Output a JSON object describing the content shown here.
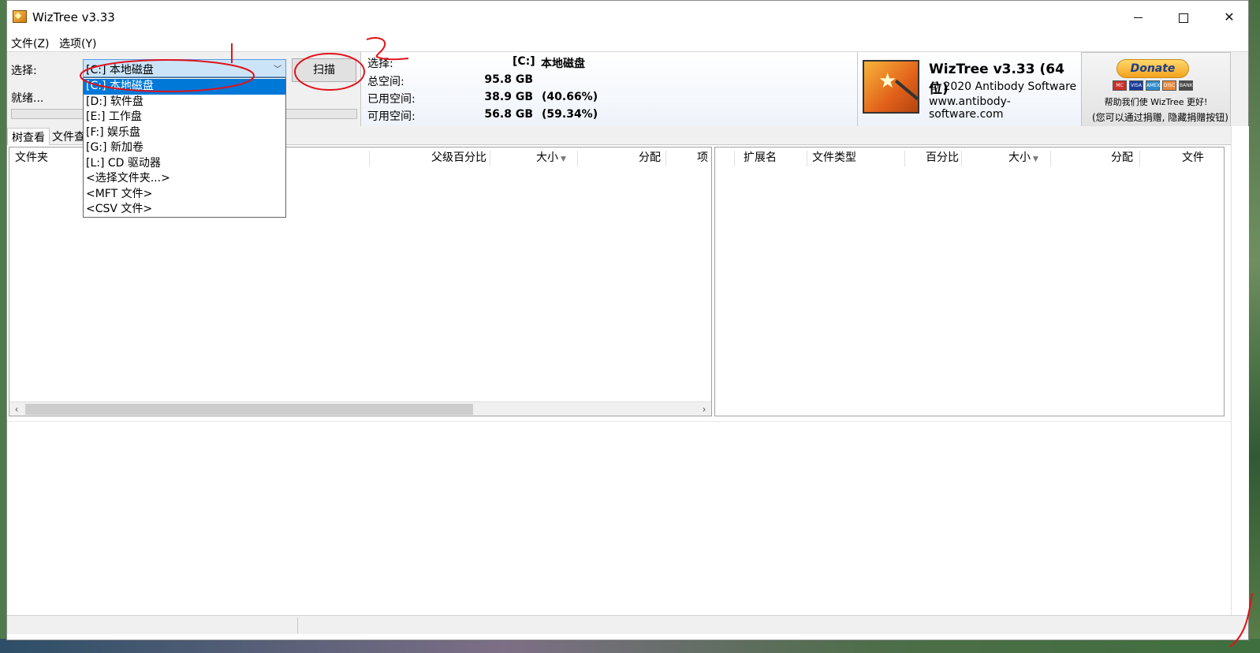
{
  "window": {
    "title": "WizTree v3.33",
    "min_glyph": "",
    "close_glyph": "✕"
  },
  "menu": [
    "文件(Z)",
    "选项(Y)"
  ],
  "toolbar": {
    "select_label": "选择:",
    "status_label": "就绪...",
    "combo_value": "[C:] 本地磁盘",
    "combo_arrow": "﹀",
    "scan_label": "扫描"
  },
  "drive_info": {
    "select_label": "选择:",
    "drive": "[C:]",
    "drive_name": "本地磁盘",
    "total_label": "总空间:",
    "total_value": "95.8 GB",
    "used_label": "已用空间:",
    "used_value": "38.9 GB",
    "used_pct": "(40.66%)",
    "free_label": "可用空间:",
    "free_value": "56.8 GB",
    "free_pct": "(59.34%)"
  },
  "brand": {
    "title": "WizTree v3.33 (64 位)",
    "copyright": "© 2020 Antibody Software",
    "website": "www.antibody-software.com"
  },
  "donate": {
    "button_label": "Donate",
    "help_text": "帮助我们使 WizTree 更好!",
    "note": "(您可以通过捐赠, 隐藏捐赠按钮)",
    "cards": [
      "MC",
      "VISA",
      "AMEX",
      "DISC",
      "BANK"
    ]
  },
  "tabs": [
    "树查看",
    "文件查看"
  ],
  "tree_columns": [
    "文件夹",
    "父级百分比",
    "大小",
    "分配",
    "项"
  ],
  "ext_columns": [
    "扩展名",
    "文件类型",
    "百分比",
    "大小",
    "分配",
    "文件"
  ],
  "scroll": {
    "left": "‹",
    "right": "›"
  },
  "dropdown_items": [
    "[C:] 本地磁盘",
    "[D:] 软件盘",
    "[E:] 工作盘",
    "[F:] 娱乐盘",
    "[G:] 新加卷",
    "[L:] CD 驱动器",
    "<选择文件夹...>",
    "<MFT 文件>",
    "<CSV 文件>"
  ],
  "colors": {
    "selection": "#0078d7",
    "annotation": "#e0121b",
    "combo_bg": "#cce4f7"
  }
}
